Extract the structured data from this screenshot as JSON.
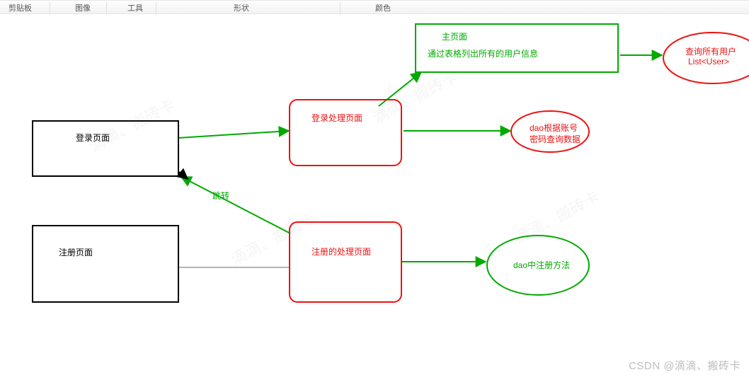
{
  "toolbar": {
    "items": [
      "剪贴板",
      "图像",
      "工具",
      "形状",
      "颜色"
    ]
  },
  "nodes": {
    "login_page": {
      "label": "登录页面"
    },
    "register_page": {
      "label": "注册页面"
    },
    "login_proc": {
      "label": "登录处理页面"
    },
    "register_proc": {
      "label": "注册的处理页面"
    },
    "main_page": {
      "title": "主页面",
      "desc": "通过表格列出所有的用户信息"
    },
    "dao_login": {
      "line1": "dao根据账号",
      "line2": "密码查询数据"
    },
    "dao_register": {
      "label": "dao中注册方法"
    },
    "dao_query_all": {
      "line1": "查询所有用户",
      "line2": "List<User>"
    }
  },
  "edges": {
    "jump_label": "跳转"
  },
  "watermark": {
    "bottom": "CSDN @滴滴、搬砖卡",
    "diagonal": "滴滴、搬砖卡"
  }
}
